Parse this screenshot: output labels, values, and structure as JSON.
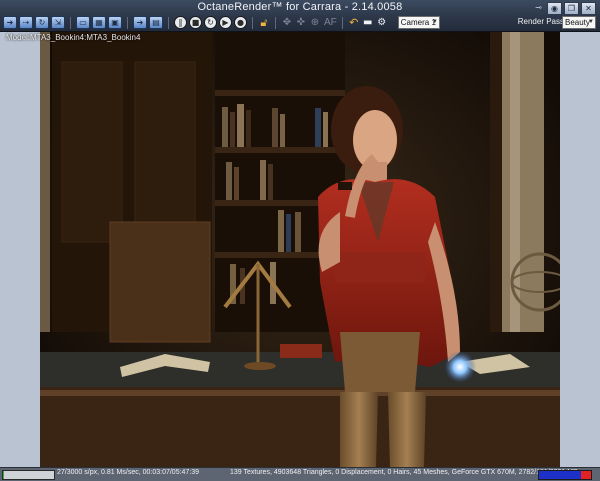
{
  "window": {
    "title": "OctaneRender™ for Carrara - 2.14.0058"
  },
  "toolbar": {
    "af_label": "AF",
    "camera_select": "Camera 1",
    "render_pass_label": "Render Pass",
    "render_pass_select": "Beauty"
  },
  "viewport": {
    "model_label": "Model:MTA3_Bookin4:MTA3_Bookin4"
  },
  "status": {
    "progress_fraction": 0.009,
    "left_text": "27/3000 s/px, 0.81 Ms/sec, 00:03:07/05:47:39",
    "right_text": "139 Textures, 4903648 Triangles, 0 Displacement, 0 Hairs, 45 Meshes, GeForce GTX 670M, 2782/181/3221 MB"
  },
  "colors": {
    "toolbar": "#2c3749",
    "side_panel": "#b9c3d1",
    "progress": "#2fb43c",
    "memory_used": "#1d31c8",
    "memory_warn": "#e12323"
  }
}
